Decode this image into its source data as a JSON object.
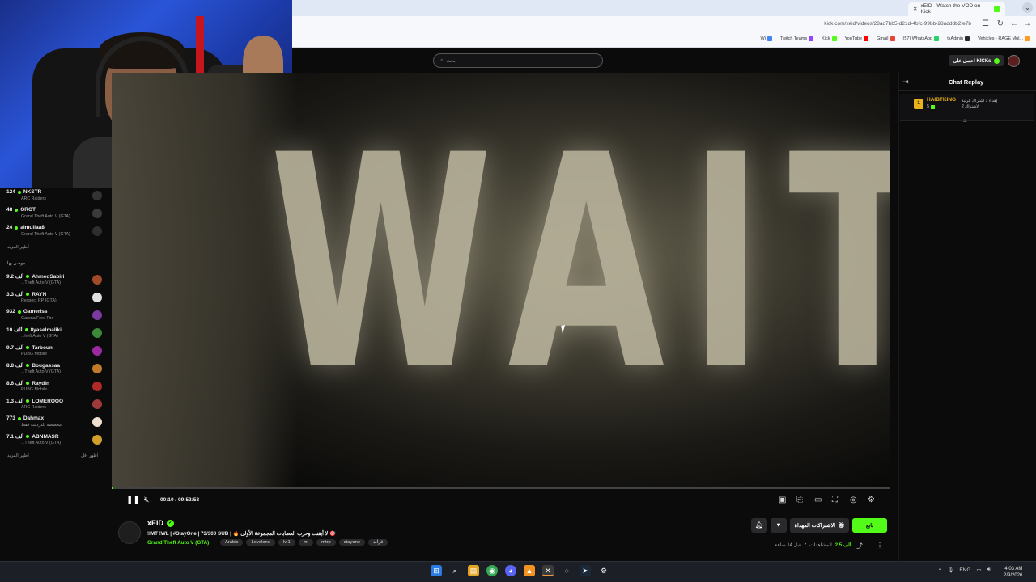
{
  "browser": {
    "active_tab_title": "xEID - Watch the VOD on Kick",
    "url": "kick.com/xeid/videos/28ad7bb5-d21d-4bfc-99bb-28adddb2fe7b",
    "bookmarks": [
      {
        "label": "Vehicles - RAGE Mul...",
        "color": "#ff9a1f"
      },
      {
        "label": "txAdmin",
        "color": "#2a2a2a"
      },
      {
        "label": "(57) WhatsApp",
        "color": "#25d366"
      },
      {
        "label": "Gmail",
        "color": "#ea4335"
      },
      {
        "label": "YouTube",
        "color": "#ff0000"
      },
      {
        "label": "Kick",
        "color": "#53fc18"
      },
      {
        "label": "Twitch Teams",
        "color": "#9146ff"
      },
      {
        "label": "Wi",
        "color": "#4285f4"
      }
    ]
  },
  "kick": {
    "search_placeholder": "بحث",
    "get_kicks_label": "احصل على KICKs"
  },
  "sidebar": {
    "channels_top": [
      {
        "viewers": "124",
        "name": "NKSTR",
        "game": "ARC Raiders",
        "avatar": "#333"
      },
      {
        "viewers": "48",
        "name": "ORGT",
        "game": "Grand Theft Auto V (GTA)",
        "avatar": "#3a3a3a"
      },
      {
        "viewers": "24",
        "name": "almullaa8",
        "game": "Grand Theft Auto V (GTA)",
        "avatar": "#2e2e2e"
      }
    ],
    "show_more_1": "أظهر المزيد",
    "recommended_heading": "موصى بها",
    "channels_recommended": [
      {
        "viewers": "9.2 ألف",
        "name": "AhmedSabiri",
        "game": "...Theft Auto V (GTA)",
        "avatar": "#a04a2a"
      },
      {
        "viewers": "3.3 ألف",
        "name": "RAYN",
        "game": "Respect RP (GTA)",
        "avatar": "#e0e0e0"
      },
      {
        "viewers": "932",
        "name": "Gameriss",
        "game": "Garena Free Fire",
        "avatar": "#7a3aa0"
      },
      {
        "viewers": "10 ألف",
        "name": "8yaselmaliki",
        "game": "...heft Auto V (GTA)",
        "avatar": "#3a8a3a"
      },
      {
        "viewers": "9.7 ألف",
        "name": "Tarboun",
        "game": "PUBG Mobile",
        "avatar": "#9a2aa0"
      },
      {
        "viewers": "8.8 ألف",
        "name": "Bougassaa",
        "game": "...Theft Auto V (GTA)",
        "avatar": "#c07a2a"
      },
      {
        "viewers": "8.6 ألف",
        "name": "Raydin",
        "game": "PUBG Mobile",
        "avatar": "#b02a2a"
      },
      {
        "viewers": "1.3 ألف",
        "name": "LOMEROOO",
        "game": "ARC Raiders",
        "avatar": "#a03a3a"
      },
      {
        "viewers": "773",
        "name": "Dahmax",
        "game": "مخصصة للدردشة فقط",
        "avatar": "#f0e0d0"
      },
      {
        "viewers": "7.1 ألف",
        "name": "ABNMASR",
        "game": "...Theft Auto V (GTA)",
        "avatar": "#d0a02a"
      }
    ],
    "show_more_2": "أظهر المزيد",
    "show_less": "أظهر أقل"
  },
  "video": {
    "overlay_text": "WAITING",
    "elapsed": "00:10",
    "duration": "09:52:53",
    "progress_fraction": 0.0003
  },
  "stream": {
    "streamer": "xEID",
    "title": "!IMT !WL | #StayOne | 73/300 SUB | 🔥 لا أيفنت وحرب العصابات المجموعة الأولى 🎯",
    "game": "Grand Theft Auto V (GTA)",
    "tags": [
      "Arabic",
      "Levelone",
      "lvl1",
      "mt",
      "mtrp",
      "stayone",
      "قراند"
    ],
    "follow_label": "تابع",
    "gift_label": "الاشتراكات المهداة",
    "views_count": "2.5 ألف",
    "views_label": "المشاهدات",
    "ago": "قبل 14 ساعة"
  },
  "chat": {
    "title": "Chat Replay",
    "pinned_rank": "1",
    "pinned_user": "HAIBTKING",
    "pinned_sub": "5",
    "pinned_message": "إهداء 1 اشتراك للرتبة الاشتراك 2"
  },
  "taskbar": {
    "language": "ENG",
    "time": "4:03 AM",
    "date": "2/9/2026"
  }
}
